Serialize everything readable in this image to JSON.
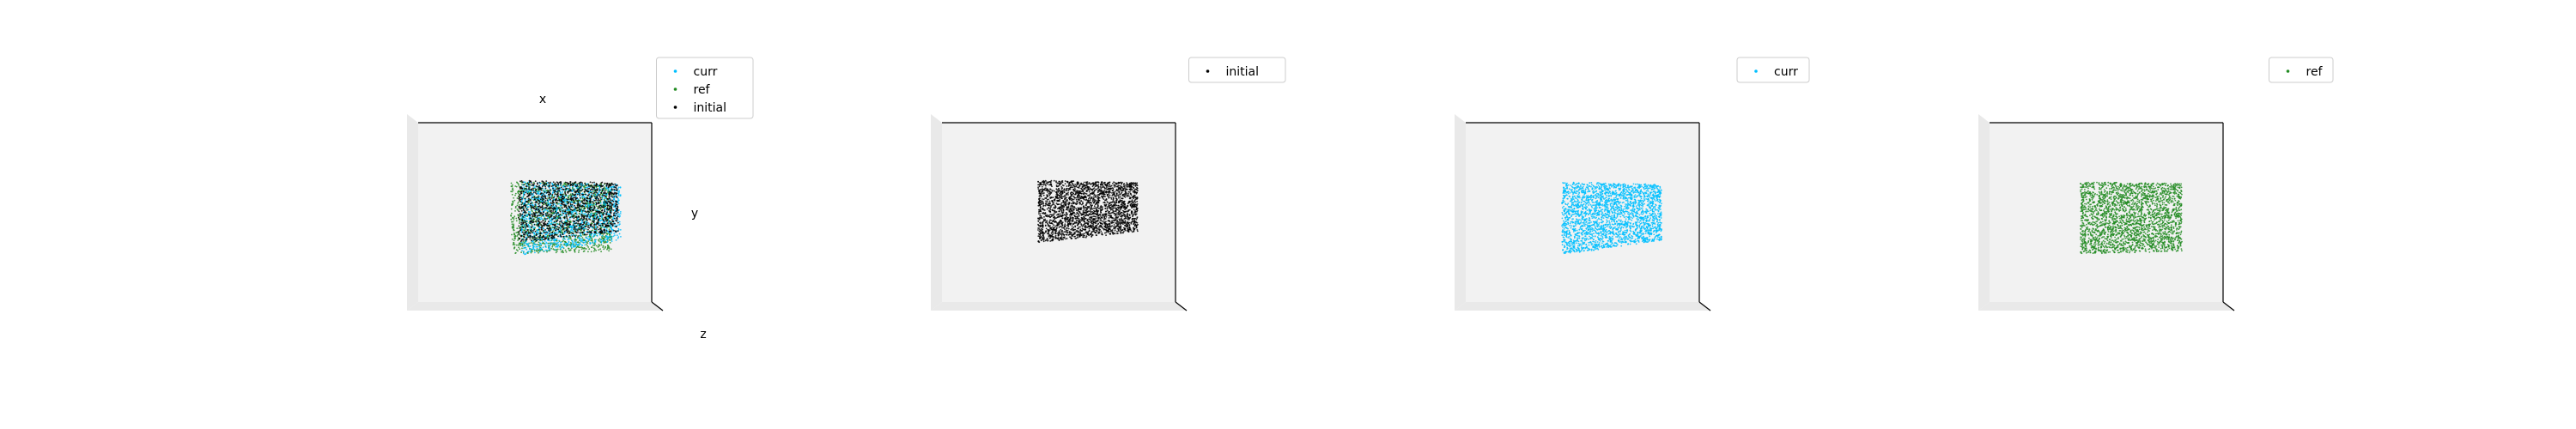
{
  "colors": {
    "curr": "#00bfff",
    "ref": "#228b22",
    "initial": "#000000",
    "pane": "#f2f2f2",
    "pane_side": "#e9e9e9",
    "legend_border": "#cccccc"
  },
  "chart_data": [
    {
      "type": "scatter",
      "projection": "3d",
      "axis_labels": {
        "x": "x",
        "y": "y",
        "z": "z"
      },
      "legend": {
        "placement": "upper-right",
        "entries": [
          "curr",
          "ref",
          "initial"
        ]
      },
      "series": [
        {
          "name": "curr",
          "color": "#00bfff",
          "shape": "box",
          "x": [
            -0.3,
            0.3
          ],
          "y": [
            -0.25,
            0.25
          ],
          "z": [
            -0.2,
            0.2
          ]
        },
        {
          "name": "ref",
          "color": "#228b22",
          "shape": "box",
          "x": [
            -0.3,
            0.3
          ],
          "y": [
            -0.3,
            0.2
          ],
          "z": [
            -0.2,
            0.2
          ]
        },
        {
          "name": "initial",
          "color": "#000000",
          "shape": "box",
          "x": [
            -0.3,
            0.3
          ],
          "y": [
            -0.2,
            0.3
          ],
          "z": [
            -0.2,
            0.2
          ]
        }
      ]
    },
    {
      "type": "scatter",
      "projection": "3d",
      "axis_labels": {
        "x": "",
        "y": "",
        "z": ""
      },
      "legend": {
        "placement": "upper-right",
        "entries": [
          "initial"
        ]
      },
      "series": [
        {
          "name": "initial",
          "color": "#000000",
          "shape": "box",
          "x": [
            -0.3,
            0.3
          ],
          "y": [
            -0.2,
            0.3
          ],
          "z": [
            -0.2,
            0.2
          ]
        }
      ]
    },
    {
      "type": "scatter",
      "projection": "3d",
      "axis_labels": {
        "x": "",
        "y": "",
        "z": ""
      },
      "legend": {
        "placement": "upper-right",
        "entries": [
          "curr"
        ]
      },
      "series": [
        {
          "name": "curr",
          "color": "#00bfff",
          "shape": "box",
          "x": [
            -0.3,
            0.3
          ],
          "y": [
            -0.25,
            0.25
          ],
          "z": [
            -0.2,
            0.2
          ]
        }
      ]
    },
    {
      "type": "scatter",
      "projection": "3d",
      "axis_labels": {
        "x": "",
        "y": "",
        "z": ""
      },
      "legend": {
        "placement": "upper-right",
        "entries": [
          "ref"
        ]
      },
      "series": [
        {
          "name": "ref",
          "color": "#228b22",
          "shape": "box",
          "x": [
            -0.3,
            0.3
          ],
          "y": [
            -0.3,
            0.2
          ],
          "z": [
            -0.2,
            0.2
          ]
        }
      ]
    }
  ]
}
